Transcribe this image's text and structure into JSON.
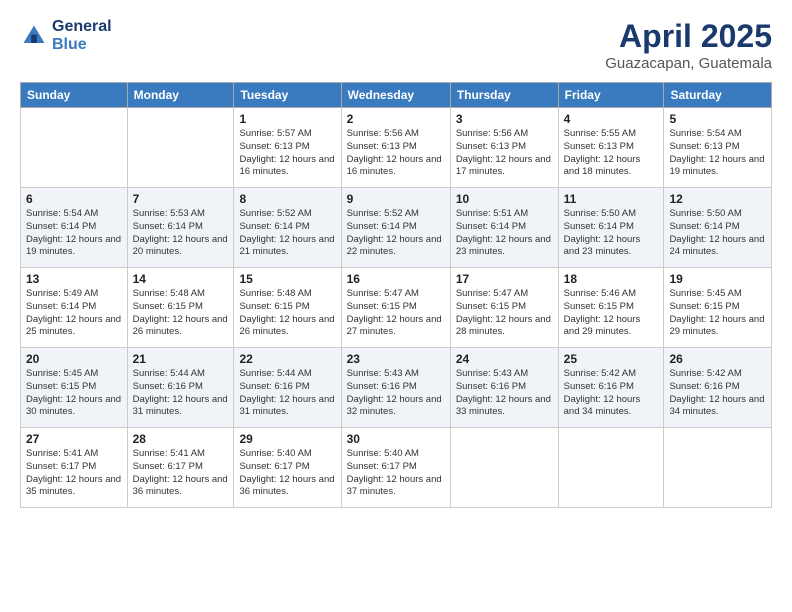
{
  "header": {
    "logo_line1": "General",
    "logo_line2": "Blue",
    "title": "April 2025",
    "subtitle": "Guazacapan, Guatemala"
  },
  "days_of_week": [
    "Sunday",
    "Monday",
    "Tuesday",
    "Wednesday",
    "Thursday",
    "Friday",
    "Saturday"
  ],
  "weeks": [
    [
      {
        "day": "",
        "info": ""
      },
      {
        "day": "",
        "info": ""
      },
      {
        "day": "1",
        "info": "Sunrise: 5:57 AM\nSunset: 6:13 PM\nDaylight: 12 hours and 16 minutes."
      },
      {
        "day": "2",
        "info": "Sunrise: 5:56 AM\nSunset: 6:13 PM\nDaylight: 12 hours and 16 minutes."
      },
      {
        "day": "3",
        "info": "Sunrise: 5:56 AM\nSunset: 6:13 PM\nDaylight: 12 hours and 17 minutes."
      },
      {
        "day": "4",
        "info": "Sunrise: 5:55 AM\nSunset: 6:13 PM\nDaylight: 12 hours and 18 minutes."
      },
      {
        "day": "5",
        "info": "Sunrise: 5:54 AM\nSunset: 6:13 PM\nDaylight: 12 hours and 19 minutes."
      }
    ],
    [
      {
        "day": "6",
        "info": "Sunrise: 5:54 AM\nSunset: 6:14 PM\nDaylight: 12 hours and 19 minutes."
      },
      {
        "day": "7",
        "info": "Sunrise: 5:53 AM\nSunset: 6:14 PM\nDaylight: 12 hours and 20 minutes."
      },
      {
        "day": "8",
        "info": "Sunrise: 5:52 AM\nSunset: 6:14 PM\nDaylight: 12 hours and 21 minutes."
      },
      {
        "day": "9",
        "info": "Sunrise: 5:52 AM\nSunset: 6:14 PM\nDaylight: 12 hours and 22 minutes."
      },
      {
        "day": "10",
        "info": "Sunrise: 5:51 AM\nSunset: 6:14 PM\nDaylight: 12 hours and 23 minutes."
      },
      {
        "day": "11",
        "info": "Sunrise: 5:50 AM\nSunset: 6:14 PM\nDaylight: 12 hours and 23 minutes."
      },
      {
        "day": "12",
        "info": "Sunrise: 5:50 AM\nSunset: 6:14 PM\nDaylight: 12 hours and 24 minutes."
      }
    ],
    [
      {
        "day": "13",
        "info": "Sunrise: 5:49 AM\nSunset: 6:14 PM\nDaylight: 12 hours and 25 minutes."
      },
      {
        "day": "14",
        "info": "Sunrise: 5:48 AM\nSunset: 6:15 PM\nDaylight: 12 hours and 26 minutes."
      },
      {
        "day": "15",
        "info": "Sunrise: 5:48 AM\nSunset: 6:15 PM\nDaylight: 12 hours and 26 minutes."
      },
      {
        "day": "16",
        "info": "Sunrise: 5:47 AM\nSunset: 6:15 PM\nDaylight: 12 hours and 27 minutes."
      },
      {
        "day": "17",
        "info": "Sunrise: 5:47 AM\nSunset: 6:15 PM\nDaylight: 12 hours and 28 minutes."
      },
      {
        "day": "18",
        "info": "Sunrise: 5:46 AM\nSunset: 6:15 PM\nDaylight: 12 hours and 29 minutes."
      },
      {
        "day": "19",
        "info": "Sunrise: 5:45 AM\nSunset: 6:15 PM\nDaylight: 12 hours and 29 minutes."
      }
    ],
    [
      {
        "day": "20",
        "info": "Sunrise: 5:45 AM\nSunset: 6:15 PM\nDaylight: 12 hours and 30 minutes."
      },
      {
        "day": "21",
        "info": "Sunrise: 5:44 AM\nSunset: 6:16 PM\nDaylight: 12 hours and 31 minutes."
      },
      {
        "day": "22",
        "info": "Sunrise: 5:44 AM\nSunset: 6:16 PM\nDaylight: 12 hours and 31 minutes."
      },
      {
        "day": "23",
        "info": "Sunrise: 5:43 AM\nSunset: 6:16 PM\nDaylight: 12 hours and 32 minutes."
      },
      {
        "day": "24",
        "info": "Sunrise: 5:43 AM\nSunset: 6:16 PM\nDaylight: 12 hours and 33 minutes."
      },
      {
        "day": "25",
        "info": "Sunrise: 5:42 AM\nSunset: 6:16 PM\nDaylight: 12 hours and 34 minutes."
      },
      {
        "day": "26",
        "info": "Sunrise: 5:42 AM\nSunset: 6:16 PM\nDaylight: 12 hours and 34 minutes."
      }
    ],
    [
      {
        "day": "27",
        "info": "Sunrise: 5:41 AM\nSunset: 6:17 PM\nDaylight: 12 hours and 35 minutes."
      },
      {
        "day": "28",
        "info": "Sunrise: 5:41 AM\nSunset: 6:17 PM\nDaylight: 12 hours and 36 minutes."
      },
      {
        "day": "29",
        "info": "Sunrise: 5:40 AM\nSunset: 6:17 PM\nDaylight: 12 hours and 36 minutes."
      },
      {
        "day": "30",
        "info": "Sunrise: 5:40 AM\nSunset: 6:17 PM\nDaylight: 12 hours and 37 minutes."
      },
      {
        "day": "",
        "info": ""
      },
      {
        "day": "",
        "info": ""
      },
      {
        "day": "",
        "info": ""
      }
    ]
  ]
}
